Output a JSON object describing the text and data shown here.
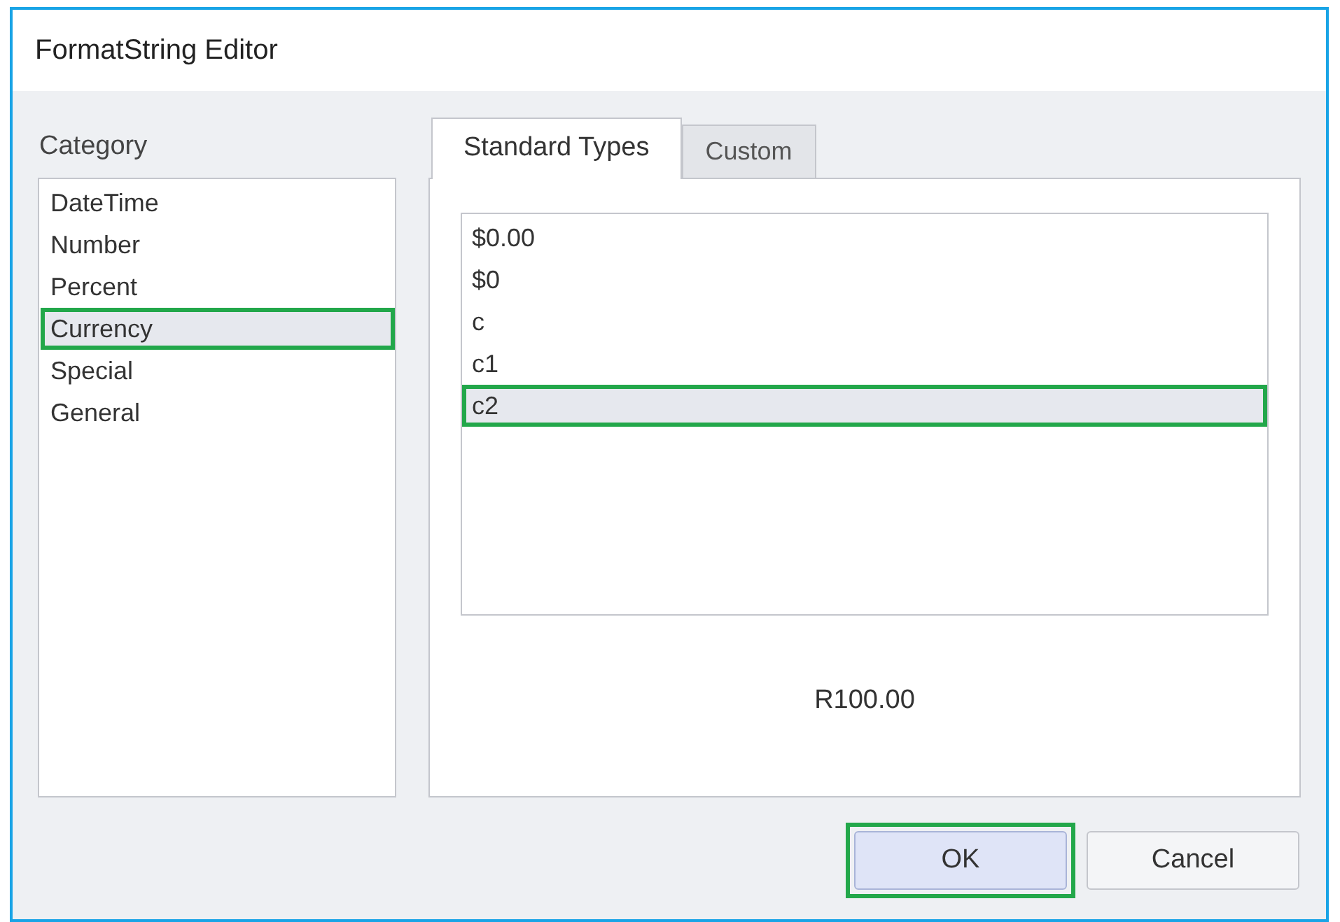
{
  "window": {
    "title": "FormatString Editor"
  },
  "category": {
    "label": "Category",
    "items": [
      {
        "label": "DateTime",
        "selected": false,
        "highlighted": false
      },
      {
        "label": "Number",
        "selected": false,
        "highlighted": false
      },
      {
        "label": "Percent",
        "selected": false,
        "highlighted": false
      },
      {
        "label": "Currency",
        "selected": true,
        "highlighted": true
      },
      {
        "label": "Special",
        "selected": false,
        "highlighted": false
      },
      {
        "label": "General",
        "selected": false,
        "highlighted": false
      }
    ]
  },
  "tabs": [
    {
      "label": "Standard Types",
      "selected": true
    },
    {
      "label": "Custom",
      "selected": false
    }
  ],
  "formats": [
    {
      "label": "$0.00",
      "selected": false,
      "highlighted": false
    },
    {
      "label": "$0",
      "selected": false,
      "highlighted": false
    },
    {
      "label": "c",
      "selected": false,
      "highlighted": false
    },
    {
      "label": "c1",
      "selected": false,
      "highlighted": false
    },
    {
      "label": "c2",
      "selected": true,
      "highlighted": true
    }
  ],
  "preview": "R100.00",
  "buttons": [
    {
      "label": "OK",
      "highlighted": true,
      "default": true
    },
    {
      "label": "Cancel",
      "highlighted": false,
      "default": false
    }
  ]
}
